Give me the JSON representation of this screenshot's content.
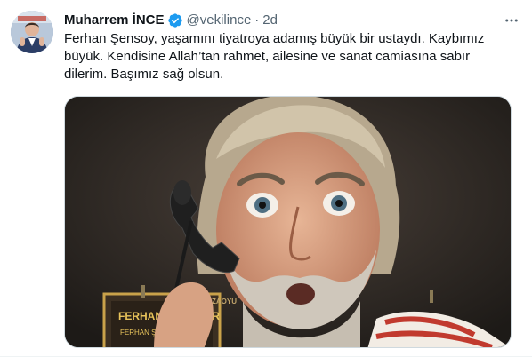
{
  "tweet": {
    "author": {
      "display_name": "Muharrem İNCE",
      "handle": "@vekilince",
      "verified": true,
      "avatar_icon": "profile-photo"
    },
    "separator": "·",
    "timestamp": "2d",
    "text_lines": [
      "Ferhan Şensoy, yaşamını tiyatroya adamış büyük bir ustaydı. Kaybımız",
      "büyük. Kendisine Allah’tan rahmet, ailesine ve sanat camiasına sabır",
      "dilerim. Başımız sağ olsun."
    ],
    "media": {
      "poster_title": "FERHANGİ ŞEYLER",
      "poster_subtitle": "FERHAN ŞENSOY",
      "corner_text": "ZAOYU"
    },
    "colors": {
      "verified_blue": "#1d9bf0",
      "secondary_text": "#536471",
      "primary_text": "#0f1419"
    },
    "icons": {
      "more": "more-horizontal-icon",
      "verified": "verified-badge-icon"
    }
  }
}
